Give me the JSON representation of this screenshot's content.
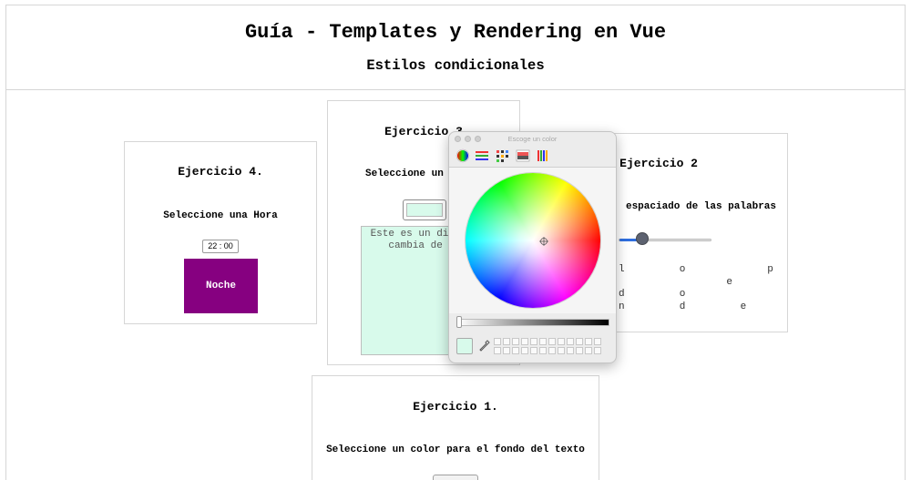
{
  "header": {
    "title": "Guía - Templates y Rendering en Vue",
    "subtitle": "Estilos condicionales"
  },
  "ejercicio4": {
    "title": "Ejercicio 4.",
    "label": "Seleccione una Hora",
    "time_value": "22 : 00",
    "result_text": "Noche",
    "result_color": "#860080"
  },
  "ejercicio3": {
    "title": "Ejercicio 3",
    "label": "Seleccione un",
    "textarea_text": "Este es un div que cambia de co",
    "color": "#d8faeb"
  },
  "ejercicio2": {
    "title": "Ejercicio 2",
    "label": "espaciado de las palabras",
    "slider_fraction": 0.2,
    "spaced_lines": [
      "l  o   p  o  c  a",
      "    e  s  t  a  m",
      "d  o    c  o  s",
      "n  d  e  n  t  e  s"
    ]
  },
  "ejercicio1": {
    "title": "Ejercicio 1.",
    "label": "Seleccione un color para el fondo del texto"
  },
  "color_picker": {
    "window_title": "Escoge un color",
    "tools": [
      "color-wheel-icon",
      "color-sliders-icon",
      "color-palettes-icon",
      "image-palettes-icon",
      "pencils-icon"
    ],
    "current_color": "#d8faeb",
    "accent": "#2f6fe0"
  }
}
